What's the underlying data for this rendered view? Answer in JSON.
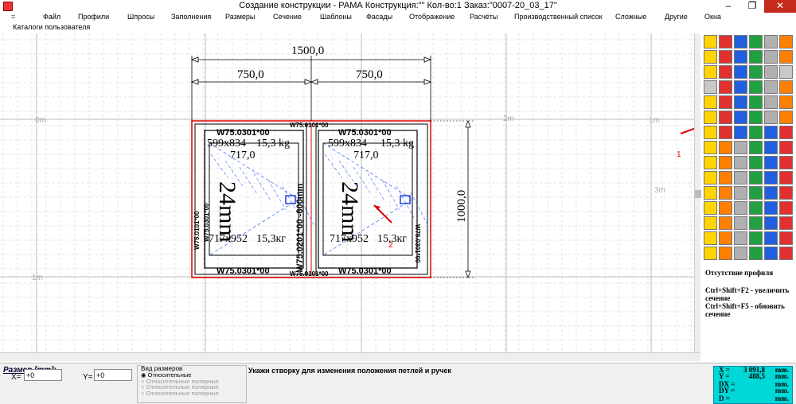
{
  "window_title": "Создание конструкции - РАМА        Конструкция:\"\" Кол-во:1  Заказ:\"0007-20_03_17\"",
  "menu": [
    "=",
    "Файл",
    "Профили",
    "Шпросы",
    "Заполнения",
    "Размеры",
    "Сечение",
    "Шаблоны",
    "Фасады",
    "Отображение",
    "Расчёты",
    "Производственный список",
    "Сложные",
    "Другие",
    "Окна"
  ],
  "submenu": "Каталоги пользователя",
  "drawing": {
    "dim_total": "1500,0",
    "dim_left": "750,0",
    "dim_right": "750,0",
    "dim_height": "1000,0",
    "profile_top_mid": "W75.0101*00",
    "profile_bottom_mid": "W75.0101*00",
    "profile_left": "W75.0101*00",
    "profile_right": "W75.0101*00",
    "sash_top": "W75.0301*00",
    "sash_bottom": "W75.0301*00",
    "sash_left_side": "W75.0301*00",
    "mullion": "W75.0201*00 -600mm",
    "mullion_right": "W75.0301*00",
    "sash_size": "599x834",
    "sash_weight": "15,3 kg",
    "glass_width": "717,0",
    "glass_thickness": "24mm",
    "glass_size": "717x952",
    "glass_weight": "15,3кг",
    "marker_1": "1",
    "marker_2": "2",
    "scale_labels": [
      "1m",
      "0m",
      "1m",
      "2m",
      "3m"
    ]
  },
  "help": {
    "title": "Отсутствие профиля",
    "line1": "Ctrl+Shift+F2 - увеличить сечение",
    "line2": "Ctrl+Shift+F5 - обновить сечение"
  },
  "status": {
    "size_label": "Размер [mm]:",
    "x_label": "X=",
    "x_value": "+0",
    "y_label": "Y=",
    "y_value": "+0",
    "view_group": "Вид размеров",
    "view_options": [
      "Относительные",
      "Относительные полярные",
      "Относительные полярные",
      "Относительные полярные"
    ],
    "hint": "Укажи створку для изменения положения петлей и ручек"
  },
  "coords": {
    "x_label": "X =",
    "x_value": "3 091,8",
    "x_unit": "mm.",
    "y_label": "Y =",
    "y_value": "488,5",
    "y_unit": "mm.",
    "dx_label": "DX =",
    "dx_value": "",
    "dx_unit": "mm.",
    "dy_label": "DY =",
    "dy_value": "",
    "dy_unit": "mm.",
    "d_label": "D =",
    "d_value": "",
    "d_unit": "mm."
  },
  "palette_icons": [
    "pencil-icon",
    "profile-icon",
    "frame-icon",
    "arc-icon",
    "move-icon",
    "cross-icon",
    "list-icon",
    "grid-icon",
    "shape-icon",
    "info-icon",
    "curve-icon",
    "pane-icon",
    "table-icon",
    "ruler-icon",
    "delete-icon",
    "mirror-icon",
    "line-icon",
    "blank-icon",
    "blank-icon",
    "sash-icon",
    "resize-icon",
    "calc-icon",
    "dxf-icon",
    "brick-icon",
    "width-icon",
    "join-icon",
    "frame2-icon",
    "edit-icon",
    "split-icon",
    "square-icon",
    "square2-icon",
    "table2-icon",
    "list2-icon",
    "grid2-icon",
    "zoom-in-icon",
    "zoom-out-icon",
    "zoom-icon",
    "settings-icon",
    "undo-icon",
    "help-icon"
  ],
  "colors": {
    "coord_panel": "#00d7d7",
    "frame_red": "#e00000",
    "hatch": "#3060ff"
  }
}
